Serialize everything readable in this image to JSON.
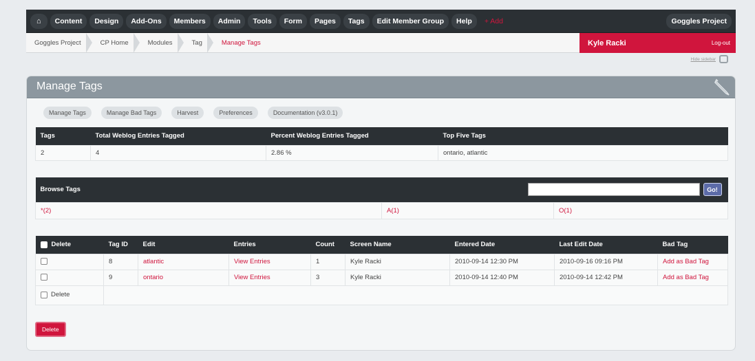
{
  "nav": {
    "home_icon": "home-icon",
    "items": [
      "Content",
      "Design",
      "Add-Ons",
      "Members",
      "Admin",
      "Tools",
      "Form",
      "Pages",
      "Tags",
      "Edit Member Group",
      "Help"
    ],
    "add_label": "+ Add",
    "site_name": "Goggles Project"
  },
  "breadcrumb": [
    "Goggles Project",
    "CP Home",
    "Modules",
    "Tag",
    "Manage Tags"
  ],
  "user": {
    "name": "Kyle Racki",
    "logout": "Log-out"
  },
  "sidebar_toggle": "Hide sidebar",
  "panel": {
    "title": "Manage Tags",
    "subtabs": [
      "Manage Tags",
      "Manage Bad Tags",
      "Harvest",
      "Preferences",
      "Documentation (v3.0.1)"
    ]
  },
  "stats": {
    "headers": [
      "Tags",
      "Total Weblog Entries Tagged",
      "Percent Weblog Entries Tagged",
      "Top Five Tags"
    ],
    "row": [
      "2",
      "4",
      "2.86 %",
      "ontario, atlantic"
    ]
  },
  "browse": {
    "header": "Browse Tags",
    "go_label": "Go!",
    "search_value": "",
    "letters": [
      "*(2)",
      "A(1)",
      "O(1)"
    ]
  },
  "tags_table": {
    "headers": [
      "Delete",
      "Tag ID",
      "Edit",
      "Entries",
      "Count",
      "Screen Name",
      "Entered Date",
      "Last Edit Date",
      "Bad Tag"
    ],
    "rows": [
      {
        "id": "8",
        "edit": "atlantic",
        "entries": "View Entries",
        "count": "1",
        "screen_name": "Kyle Racki",
        "entered": "2010-09-14 12:30 PM",
        "last_edit": "2010-09-16 09:16 PM",
        "bad_tag": "Add as Bad Tag"
      },
      {
        "id": "9",
        "edit": "ontario",
        "entries": "View Entries",
        "count": "3",
        "screen_name": "Kyle Racki",
        "entered": "2010-09-14 12:40 PM",
        "last_edit": "2010-09-14 12:42 PM",
        "bad_tag": "Add as Bad Tag"
      }
    ],
    "footer_label": "Delete"
  },
  "delete_button": "Delete",
  "colors": {
    "accent": "#d0153d",
    "nav_bg": "#2b3034",
    "panel_head": "#8c979f"
  }
}
